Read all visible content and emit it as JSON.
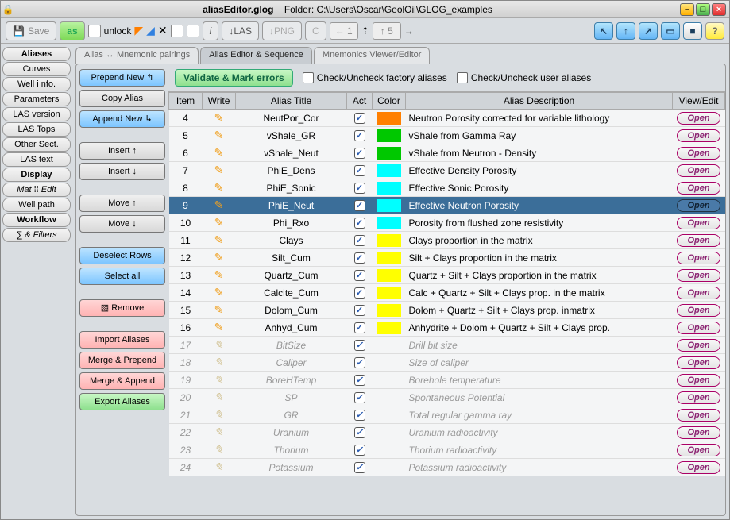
{
  "window": {
    "filename": "aliasEditor.glog",
    "folder_label": "Folder: C:\\Users\\Oscar\\GeolOil\\GLOG_examples"
  },
  "toolbar": {
    "save": "Save",
    "as": "as",
    "unlock": "unlock",
    "las": "↓LAS",
    "png": "↓PNG",
    "c": "C",
    "spin1": "← 1",
    "spin2": "↑ 5"
  },
  "leftnav": [
    {
      "label": "Aliases",
      "bold": true
    },
    {
      "label": "Curves"
    },
    {
      "label": "Well i nfo."
    },
    {
      "label": "Parameters"
    },
    {
      "label": "LAS version"
    },
    {
      "label": "LAS Tops"
    },
    {
      "label": "Other Sect."
    },
    {
      "label": "LAS text"
    },
    {
      "label": "Display",
      "bold": true
    },
    {
      "label": "Mat ⁞⁞ Edit",
      "ital": true
    },
    {
      "label": "Well path"
    },
    {
      "label": "Workflow",
      "bold": true
    },
    {
      "label": "∑ & Filters",
      "ital": true
    }
  ],
  "tabs": [
    {
      "label": "Alias ↔ Mnemonic pairings",
      "active": false
    },
    {
      "label": "Alias Editor & Sequence",
      "active": true
    },
    {
      "label": "Mnemonics Viewer/Editor",
      "active": false
    }
  ],
  "header": {
    "validate": "Validate & Mark errors",
    "check_factory": "Check/Uncheck factory aliases",
    "check_user": "Check/Uncheck user aliases"
  },
  "actions": {
    "prepend": "Prepend New ↰",
    "copy": "Copy Alias",
    "append": "Append New ↳",
    "insert_up": "Insert ↑",
    "insert_dn": "Insert ↓",
    "move_up": "Move ↑",
    "move_dn": "Move ↓",
    "deselect": "Deselect Rows",
    "select_all": "Select all",
    "remove": "▨ Remove",
    "import": "Import Aliases",
    "merge_pre": "Merge & Prepend",
    "merge_app": "Merge & Append",
    "export": "Export Aliases"
  },
  "columns": [
    "Item",
    "Write",
    "Alias Title",
    "Act",
    "Color",
    "Alias Description",
    "View/Edit"
  ],
  "open_label": "Open",
  "rows": [
    {
      "item": 4,
      "editable": true,
      "title": "NeutPor_Cor",
      "act": true,
      "color": "#ff7f00",
      "desc": "Neutron Porosity corrected for variable lithology"
    },
    {
      "item": 5,
      "editable": true,
      "title": "vShale_GR",
      "act": true,
      "color": "#00c800",
      "desc": "vShale from Gamma Ray"
    },
    {
      "item": 6,
      "editable": true,
      "title": "vShale_Neut",
      "act": true,
      "color": "#00c800",
      "desc": "vShale from Neutron - Density"
    },
    {
      "item": 7,
      "editable": true,
      "title": "PhiE_Dens",
      "act": true,
      "color": "#00ffff",
      "desc": "Effective Density Porosity"
    },
    {
      "item": 8,
      "editable": true,
      "title": "PhiE_Sonic",
      "act": true,
      "color": "#00ffff",
      "desc": "Effective Sonic Porosity"
    },
    {
      "item": 9,
      "editable": true,
      "title": "PhiE_Neut",
      "act": true,
      "color": "#00ffff",
      "desc": "Effective Neutron Porosity",
      "selected": true
    },
    {
      "item": 10,
      "editable": true,
      "title": "Phi_Rxo",
      "act": true,
      "color": "#00ffff",
      "desc": "Porosity from flushed zone resistivity"
    },
    {
      "item": 11,
      "editable": true,
      "title": "Clays",
      "act": true,
      "color": "#ffff00",
      "desc": "Clays proportion in the matrix"
    },
    {
      "item": 12,
      "editable": true,
      "title": "Silt_Cum",
      "act": true,
      "color": "#ffff00",
      "desc": "Silt + Clays proportion in the matrix"
    },
    {
      "item": 13,
      "editable": true,
      "title": "Quartz_Cum",
      "act": true,
      "color": "#ffff00",
      "desc": "Quartz + Silt + Clays proportion in the matrix"
    },
    {
      "item": 14,
      "editable": true,
      "title": "Calcite_Cum",
      "act": true,
      "color": "#ffff00",
      "desc": "Calc + Quartz + Silt + Clays prop. in the matrix"
    },
    {
      "item": 15,
      "editable": true,
      "title": "Dolom_Cum",
      "act": true,
      "color": "#ffff00",
      "desc": "Dolom + Quartz + Silt + Clays prop. inmatrix"
    },
    {
      "item": 16,
      "editable": true,
      "title": "Anhyd_Cum",
      "act": true,
      "color": "#ffff00",
      "desc": "Anhydrite + Dolom + Quartz + Silt + Clays prop."
    },
    {
      "item": 17,
      "editable": false,
      "title": "BitSize",
      "act": true,
      "color": "",
      "desc": "Drill bit size"
    },
    {
      "item": 18,
      "editable": false,
      "title": "Caliper",
      "act": true,
      "color": "",
      "desc": "Size of caliper"
    },
    {
      "item": 19,
      "editable": false,
      "title": "BoreHTemp",
      "act": true,
      "color": "",
      "desc": "Borehole temperature"
    },
    {
      "item": 20,
      "editable": false,
      "title": "SP",
      "act": true,
      "color": "",
      "desc": "Spontaneous Potential"
    },
    {
      "item": 21,
      "editable": false,
      "title": "GR",
      "act": true,
      "color": "",
      "desc": "Total regular gamma ray"
    },
    {
      "item": 22,
      "editable": false,
      "title": "Uranium",
      "act": true,
      "color": "",
      "desc": "Uranium radioactivity"
    },
    {
      "item": 23,
      "editable": false,
      "title": "Thorium",
      "act": true,
      "color": "",
      "desc": "Thorium radioactivity"
    },
    {
      "item": 24,
      "editable": false,
      "title": "Potassium",
      "act": true,
      "color": "",
      "desc": "Potassium radioactivity"
    }
  ]
}
